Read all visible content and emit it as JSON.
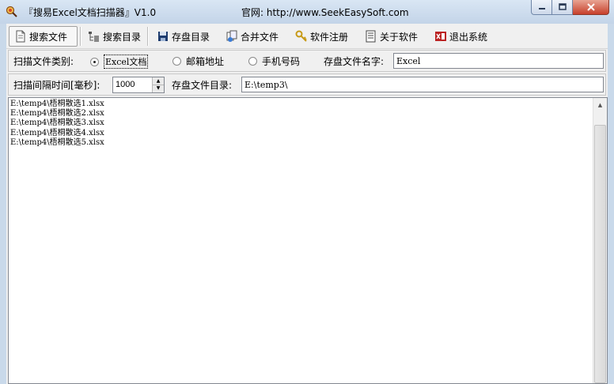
{
  "window": {
    "title": "『搜易Excel文档扫描器』V1.0",
    "website": "官网: http://www.SeekEasySoft.com",
    "controls": [
      "minimize",
      "maximize",
      "close"
    ]
  },
  "toolbar": {
    "items": [
      {
        "label": "搜索文件",
        "icon": "file-search-icon"
      },
      {
        "label": "搜索目录",
        "icon": "folder-tree-icon"
      },
      {
        "label": "存盘目录",
        "icon": "floppy-save-icon"
      },
      {
        "label": "合并文件",
        "icon": "merge-files-icon"
      },
      {
        "label": "软件注册",
        "icon": "key-icon"
      },
      {
        "label": "关于软件",
        "icon": "info-doc-icon"
      },
      {
        "label": "退出系统",
        "icon": "exit-icon"
      }
    ]
  },
  "scan_type": {
    "label": "扫描文件类别:",
    "options": [
      "Excel文档",
      "邮箱地址",
      "手机号码"
    ],
    "selected": "Excel文档",
    "save_name_label": "存盘文件名字:",
    "save_name_value": "Excel"
  },
  "interval": {
    "label": "扫描间隔时间[毫秒]:",
    "value": "1000",
    "save_dir_label": "存盘文件目录:",
    "save_dir_value": "E:\\temp3\\"
  },
  "log": {
    "lines": [
      "E:\\temp4\\梧桐散选1.xlsx",
      "E:\\temp4\\梧桐散选2.xlsx",
      "E:\\temp4\\梧桐散选3.xlsx",
      "E:\\temp4\\梧桐散选4.xlsx",
      "E:\\temp4\\梧桐散选5.xlsx"
    ]
  },
  "colors": {
    "titlebar": "#c9d9ea",
    "close_button": "#c7402b",
    "client_bg": "#f0f0f0"
  }
}
